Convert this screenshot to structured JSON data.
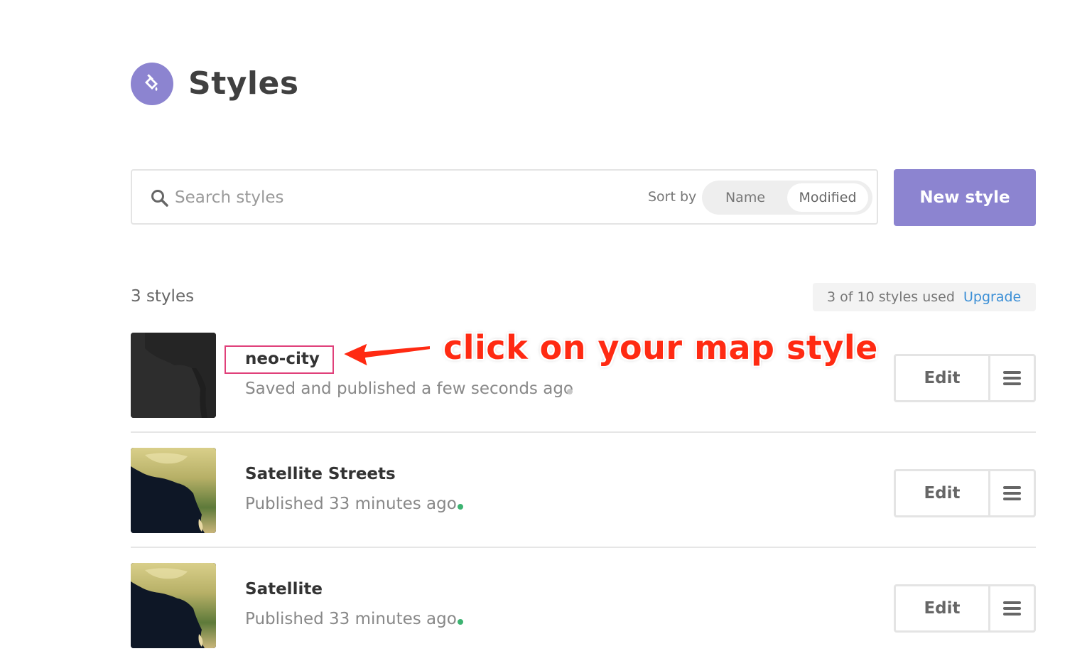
{
  "header": {
    "title": "Styles",
    "icon": "paint-bucket-icon",
    "accent_color": "#8c84d0"
  },
  "toolbar": {
    "search_placeholder": "Search styles",
    "sort_label": "Sort by",
    "sort_options": [
      "Name",
      "Modified"
    ],
    "sort_selected": "Modified",
    "new_style_label": "New style"
  },
  "summary": {
    "count_label": "3 styles",
    "usage_label": "3 of 10 styles used",
    "upgrade_label": "Upgrade"
  },
  "styles": [
    {
      "name": "neo-city",
      "status": "Saved and published a few seconds ago",
      "status_dot_color": "#c8c8c8",
      "thumbnail": "dark-map-thumbnail",
      "edit_label": "Edit"
    },
    {
      "name": "Satellite Streets",
      "status": "Published 33 minutes ago",
      "status_dot_color": "#3cb371",
      "thumbnail": "satellite-thumbnail",
      "edit_label": "Edit"
    },
    {
      "name": "Satellite",
      "status": "Published 33 minutes ago",
      "status_dot_color": "#3cb371",
      "thumbnail": "satellite-thumbnail",
      "edit_label": "Edit"
    }
  ],
  "annotation": {
    "text": "click on your map style",
    "color": "#ff2a12",
    "highlight_color": "#e0407a"
  }
}
